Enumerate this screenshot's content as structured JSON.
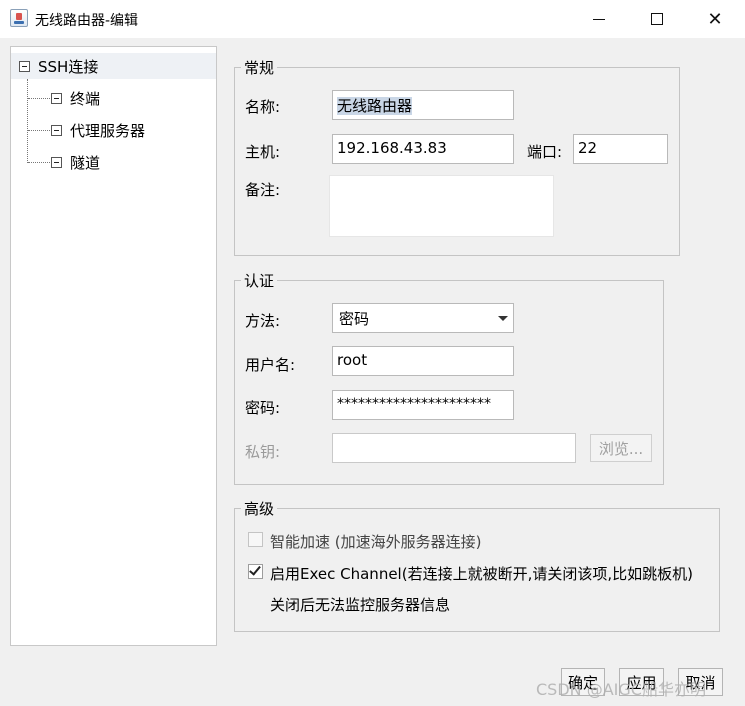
{
  "window": {
    "title": "无线路由器-编辑"
  },
  "tree": {
    "root": "SSH连接",
    "children": [
      "终端",
      "代理服务器",
      "隧道"
    ]
  },
  "general": {
    "legend": "常规",
    "name_label": "名称:",
    "name_value": "无线路由器",
    "host_label": "主机:",
    "host_value": "192.168.43.83",
    "port_label": "端口:",
    "port_value": "22",
    "note_label": "备注:",
    "note_value": ""
  },
  "auth": {
    "legend": "认证",
    "method_label": "方法:",
    "method_value": "密码",
    "username_label": "用户名:",
    "username_value": "root",
    "password_label": "密码:",
    "password_value": "**********************",
    "privkey_label": "私钥:",
    "privkey_value": "",
    "browse_label": "浏览..."
  },
  "advanced": {
    "legend": "高级",
    "smart_accel_label": "智能加速 (加速海外服务器连接)",
    "smart_accel_checked": false,
    "exec_channel_label": "启用Exec Channel(若连接上就被断开,请关闭该项,比如跳板机)",
    "exec_channel_checked": true,
    "exec_channel_note": "关闭后无法监控服务器信息"
  },
  "footer": {
    "ok_label": "确定",
    "apply_label": "应用",
    "cancel_label": "取消"
  },
  "watermark": "CSDN @AIGC船华亦明"
}
